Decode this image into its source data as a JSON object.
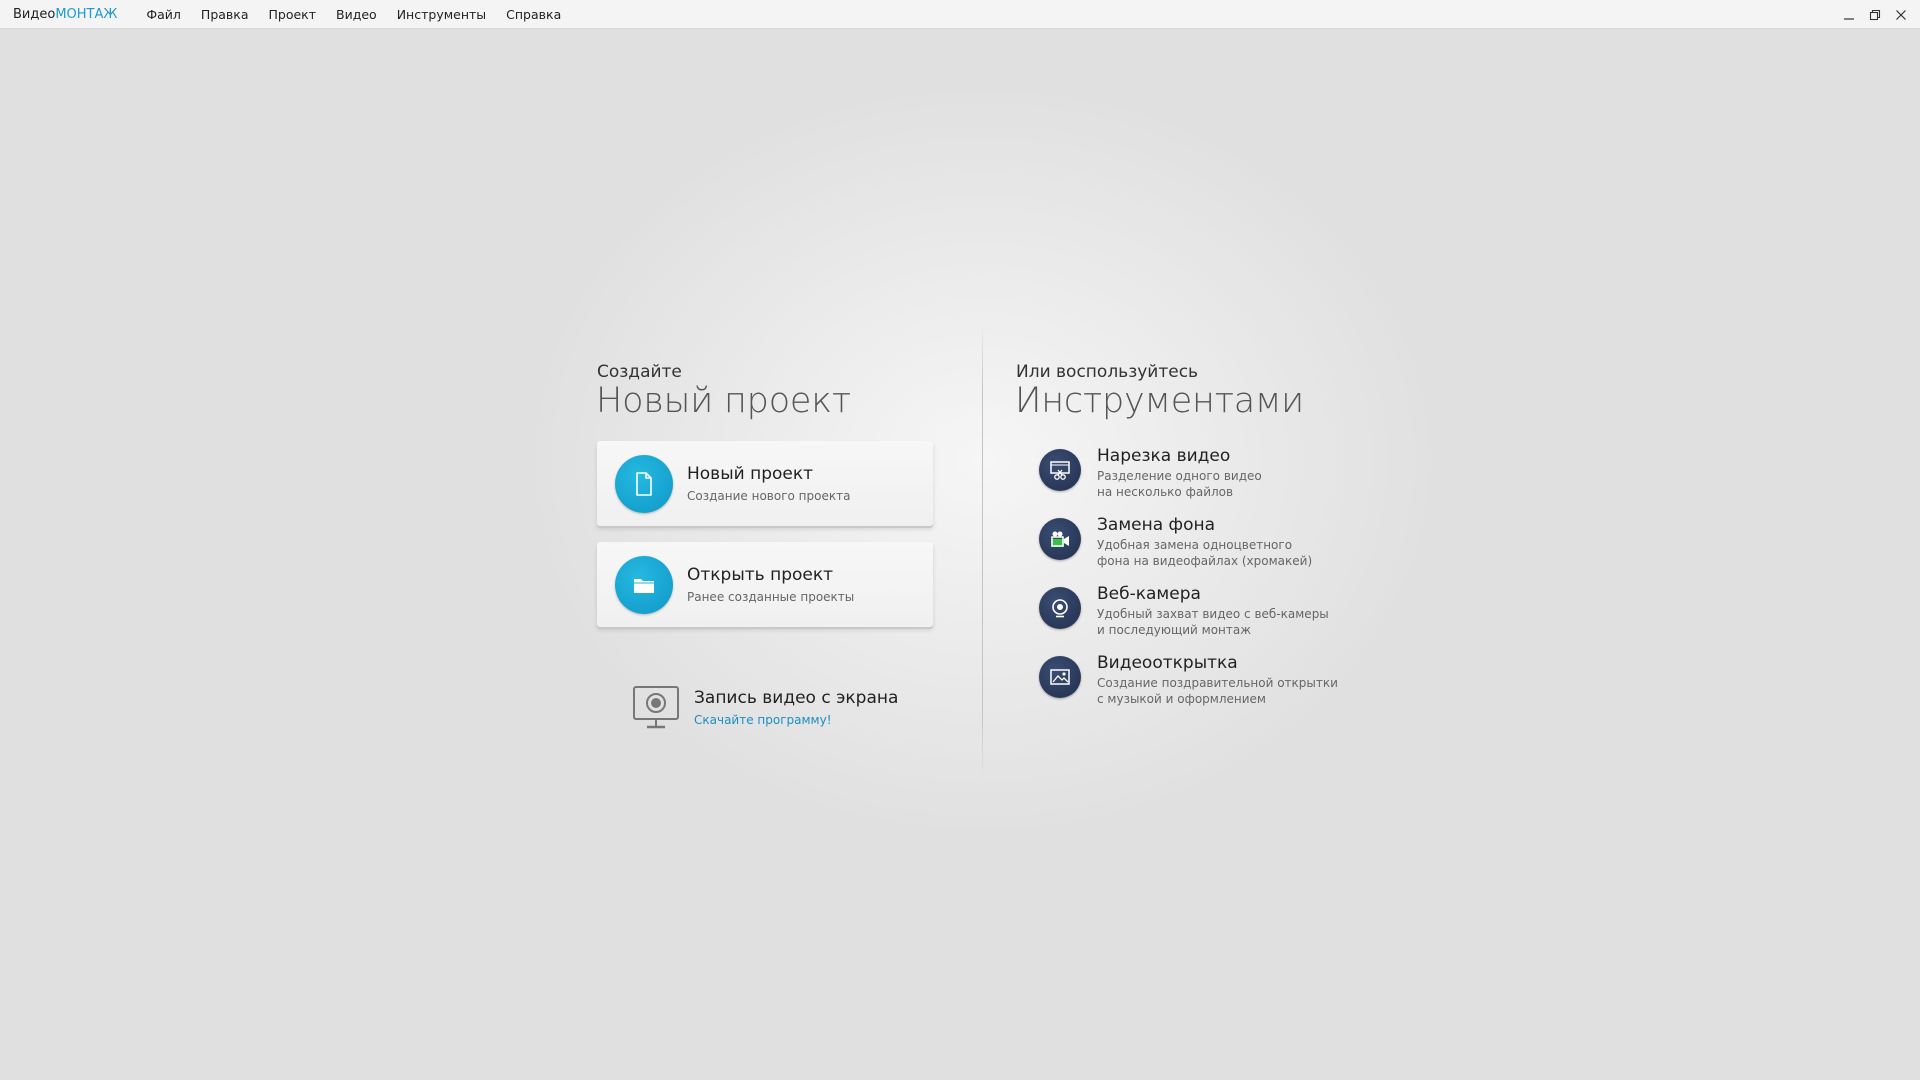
{
  "app": {
    "logo_prefix": "Видео",
    "logo_accent": "МОНТАЖ",
    "accent_color": "#1a9bcf"
  },
  "menu": {
    "items": [
      "Файл",
      "Правка",
      "Проект",
      "Видео",
      "Инструменты",
      "Справка"
    ]
  },
  "window_controls": [
    "minimize-icon",
    "restore-icon",
    "close-icon"
  ],
  "left": {
    "heading_small": "Создайте",
    "heading_big": "Новый проект",
    "cards": [
      {
        "title": "Новый проект",
        "subtitle": "Создание нового проекта",
        "icon": "document-icon"
      },
      {
        "title": "Открыть проект",
        "subtitle": "Ранее созданные проекты",
        "icon": "folder-icon"
      }
    ],
    "record": {
      "title": "Запись видео с экрана",
      "link": "Скачайте программу!",
      "icon": "monitor-webcam-icon"
    }
  },
  "right": {
    "heading_small": "Или воспользуйтесь",
    "heading_big": "Инструментами",
    "tools": [
      {
        "title": "Нарезка видео",
        "desc": "Разделение одного видео\nна несколько файлов",
        "icon": "video-cut-icon"
      },
      {
        "title": "Замена фона",
        "desc": "Удобная замена одноцветного\nфона на видеофайлах (хромакей)",
        "icon": "chroma-key-icon"
      },
      {
        "title": "Веб-камера",
        "desc": "Удобный захват видео с веб-камеры\nи последующий монтаж",
        "icon": "webcam-icon"
      },
      {
        "title": "Видеооткрытка",
        "desc": "Создание поздравительной открытки\nс музыкой и оформлением",
        "icon": "postcard-icon"
      }
    ]
  }
}
